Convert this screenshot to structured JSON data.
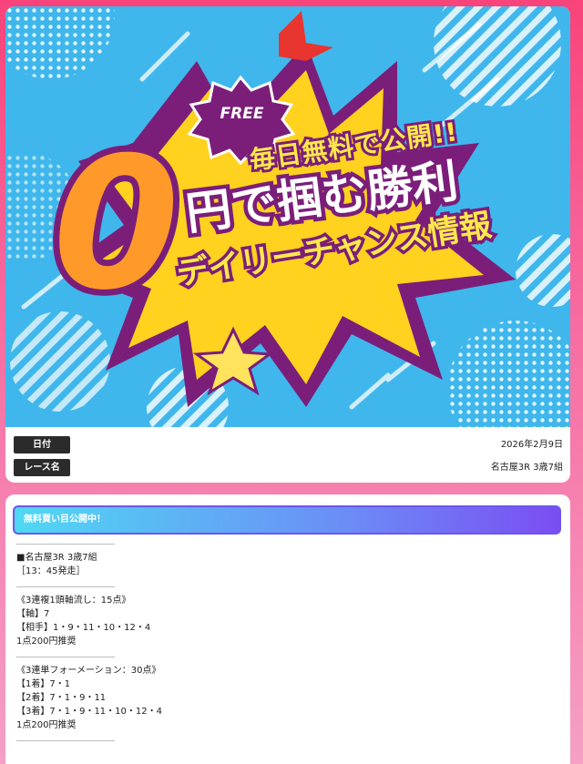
{
  "banner": {
    "free_badge": "FREE",
    "headline_top": "毎日無料で公開!!",
    "headline_zero": "0",
    "headline_main": "円で掴む勝利",
    "headline_sub": "デイリーチャンス情報"
  },
  "info": {
    "date_label": "日付",
    "date_value": "2026年2月9日",
    "race_label": "レース名",
    "race_value": "名古屋3R 3歳7組"
  },
  "free_section": {
    "header": "無料買い目公開中！",
    "race_title": "■名古屋3R 3歳7組",
    "start_time": "［13：45発走］",
    "bet1": {
      "type": "《3連複1頭軸流し：15点》",
      "axis": "【軸】7",
      "partners": "【相手】1・9・11・10・12・4",
      "stake": "1点200円推奨"
    },
    "bet2": {
      "type": "《3連単フォーメーション：30点》",
      "first": "【1着】7・1",
      "second": "【2着】7・1・9・11",
      "third": "【3着】7・1・9・11・10・12・4",
      "stake": "1点200円推奨"
    }
  },
  "colors": {
    "background": "#f8447a",
    "banner_sky": "#3fb7ec",
    "headline_purple": "#7b1e7a",
    "burst_yellow": "#ffd21f",
    "label_dark": "#2b2b2b",
    "section_gradient_start": "#4fd9f3",
    "section_gradient_end": "#7b4df2"
  }
}
